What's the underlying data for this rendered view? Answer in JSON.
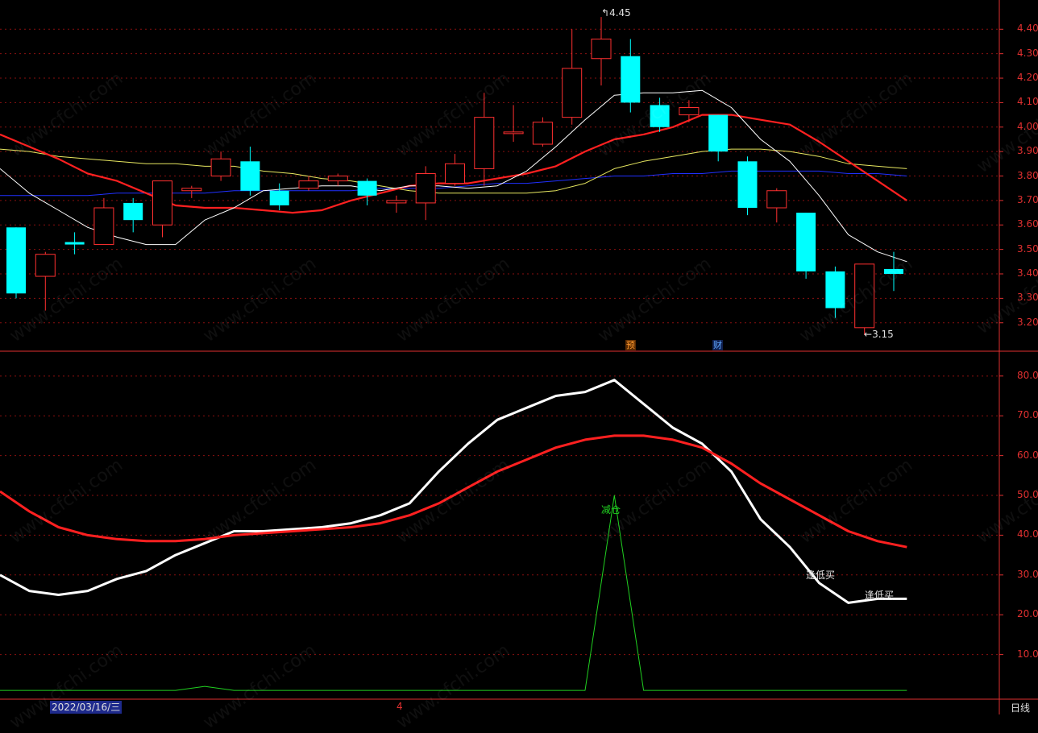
{
  "colors": {
    "bg": "#000000",
    "up": "#ff3030",
    "down": "#00ffff",
    "ma5": "#ffffff",
    "ma10": "#ff2020",
    "ma20": "#e8e860",
    "ma60": "#2030ff",
    "grid": "#8a1010",
    "axis": "#e03030",
    "signal": "#20d020"
  },
  "price_axis": {
    "ticks": [
      "4.40",
      "4.30",
      "4.20",
      "4.10",
      "4.00",
      "3.90",
      "3.80",
      "3.70",
      "3.60",
      "3.50",
      "3.40",
      "3.30",
      "3.20"
    ]
  },
  "indicator_axis": {
    "ticks": [
      "80.00",
      "70.00",
      "60.00",
      "50.00",
      "40.00",
      "30.00",
      "20.00",
      "10.00"
    ]
  },
  "annotations": {
    "high_label": "4.45",
    "low_label": "3.15",
    "tag_yu": "预",
    "tag_cai": "财",
    "reduce": "减仓",
    "buy1": "逢低买",
    "buy2": "逢低买"
  },
  "footer": {
    "date": "2022/03/16/三",
    "month_mark": "4",
    "period": "日线"
  },
  "watermark": "www.cfchi.com",
  "chart_data": [
    {
      "type": "candlestick",
      "ylim": [
        3.13,
        4.48
      ],
      "candles": [
        {
          "o": 3.59,
          "h": 3.59,
          "l": 3.3,
          "c": 3.32
        },
        {
          "o": 3.39,
          "h": 3.49,
          "l": 3.25,
          "c": 3.48
        },
        {
          "o": 3.53,
          "h": 3.57,
          "l": 3.48,
          "c": 3.52
        },
        {
          "o": 3.52,
          "h": 3.71,
          "l": 3.52,
          "c": 3.67
        },
        {
          "o": 3.69,
          "h": 3.71,
          "l": 3.57,
          "c": 3.62
        },
        {
          "o": 3.6,
          "h": 3.78,
          "l": 3.55,
          "c": 3.78
        },
        {
          "o": 3.74,
          "h": 3.76,
          "l": 3.71,
          "c": 3.75
        },
        {
          "o": 3.8,
          "h": 3.9,
          "l": 3.78,
          "c": 3.87
        },
        {
          "o": 3.86,
          "h": 3.92,
          "l": 3.72,
          "c": 3.74
        },
        {
          "o": 3.74,
          "h": 3.77,
          "l": 3.66,
          "c": 3.68
        },
        {
          "o": 3.75,
          "h": 3.8,
          "l": 3.74,
          "c": 3.78
        },
        {
          "o": 3.78,
          "h": 3.81,
          "l": 3.76,
          "c": 3.8
        },
        {
          "o": 3.78,
          "h": 3.79,
          "l": 3.68,
          "c": 3.72
        },
        {
          "o": 3.69,
          "h": 3.72,
          "l": 3.65,
          "c": 3.7
        },
        {
          "o": 3.69,
          "h": 3.84,
          "l": 3.62,
          "c": 3.81
        },
        {
          "o": 3.77,
          "h": 3.89,
          "l": 3.76,
          "c": 3.85
        },
        {
          "o": 3.83,
          "h": 4.14,
          "l": 3.76,
          "c": 4.04
        },
        {
          "o": 3.98,
          "h": 4.09,
          "l": 3.94,
          "c": 3.98
        },
        {
          "o": 3.93,
          "h": 4.04,
          "l": 3.92,
          "c": 4.02
        },
        {
          "o": 4.04,
          "h": 4.4,
          "l": 4.01,
          "c": 4.24
        },
        {
          "o": 4.28,
          "h": 4.45,
          "l": 4.17,
          "c": 4.36
        },
        {
          "o": 4.29,
          "h": 4.36,
          "l": 4.06,
          "c": 4.1
        },
        {
          "o": 4.09,
          "h": 4.12,
          "l": 3.98,
          "c": 4.0
        },
        {
          "o": 4.05,
          "h": 4.11,
          "l": 4.02,
          "c": 4.08
        },
        {
          "o": 4.05,
          "h": 4.05,
          "l": 3.86,
          "c": 3.9
        },
        {
          "o": 3.86,
          "h": 3.88,
          "l": 3.64,
          "c": 3.67
        },
        {
          "o": 3.67,
          "h": 3.75,
          "l": 3.61,
          "c": 3.74
        },
        {
          "o": 3.65,
          "h": 3.65,
          "l": 3.38,
          "c": 3.41
        },
        {
          "o": 3.41,
          "h": 3.43,
          "l": 3.22,
          "c": 3.26
        },
        {
          "o": 3.18,
          "h": 3.44,
          "l": 3.15,
          "c": 3.44
        },
        {
          "o": 3.42,
          "h": 3.49,
          "l": 3.33,
          "c": 3.4
        }
      ],
      "ma5": [
        3.83,
        3.73,
        3.66,
        3.59,
        3.55,
        3.52,
        3.52,
        3.62,
        3.67,
        3.74,
        3.75,
        3.76,
        3.76,
        3.74,
        3.76,
        3.76,
        3.75,
        3.76,
        3.82,
        3.92,
        4.03,
        4.13,
        4.14,
        4.14,
        4.15,
        4.08,
        3.95,
        3.86,
        3.72,
        3.56,
        3.49,
        3.45
      ],
      "ma10": [
        3.97,
        3.92,
        3.87,
        3.81,
        3.78,
        3.73,
        3.68,
        3.67,
        3.67,
        3.66,
        3.65,
        3.66,
        3.7,
        3.73,
        3.76,
        3.77,
        3.77,
        3.79,
        3.81,
        3.84,
        3.9,
        3.95,
        3.97,
        4.0,
        4.05,
        4.05,
        4.03,
        4.01,
        3.94,
        3.86,
        3.78,
        3.7
      ],
      "ma20": [
        3.91,
        3.9,
        3.88,
        3.87,
        3.86,
        3.85,
        3.85,
        3.84,
        3.84,
        3.82,
        3.81,
        3.79,
        3.78,
        3.76,
        3.74,
        3.73,
        3.73,
        3.73,
        3.73,
        3.74,
        3.77,
        3.83,
        3.86,
        3.88,
        3.9,
        3.91,
        3.91,
        3.9,
        3.88,
        3.85,
        3.84,
        3.83
      ],
      "ma60": [
        3.72,
        3.72,
        3.72,
        3.72,
        3.73,
        3.73,
        3.73,
        3.73,
        3.74,
        3.74,
        3.74,
        3.74,
        3.74,
        3.75,
        3.75,
        3.75,
        3.76,
        3.77,
        3.77,
        3.78,
        3.79,
        3.8,
        3.8,
        3.81,
        3.81,
        3.82,
        3.82,
        3.82,
        3.82,
        3.81,
        3.81,
        3.8
      ]
    },
    {
      "type": "line",
      "ylim": [
        0,
        83
      ],
      "series": [
        {
          "values": [
            30,
            26,
            25,
            26,
            29,
            31,
            35,
            38,
            41,
            41,
            41.5,
            42,
            43,
            45,
            48,
            56,
            63,
            69,
            72,
            75,
            76,
            79,
            73,
            67,
            63,
            56,
            44,
            37,
            28,
            23,
            24,
            24
          ]
        },
        {
          "values": [
            51,
            46,
            42,
            40,
            39,
            38.5,
            38.5,
            39,
            40,
            40.5,
            41,
            41.5,
            42,
            43,
            45,
            48,
            52,
            56,
            59,
            62,
            64,
            65,
            65,
            64,
            62,
            58,
            53,
            49,
            45,
            41,
            38.5,
            37
          ]
        },
        {
          "values": [
            1,
            1,
            1,
            1,
            1,
            1,
            1,
            2,
            1,
            1,
            1,
            1,
            1,
            1,
            1,
            1,
            1,
            1,
            1,
            1,
            1,
            50,
            1,
            1,
            1,
            1,
            1,
            1,
            1,
            1,
            1,
            1
          ]
        }
      ]
    }
  ]
}
